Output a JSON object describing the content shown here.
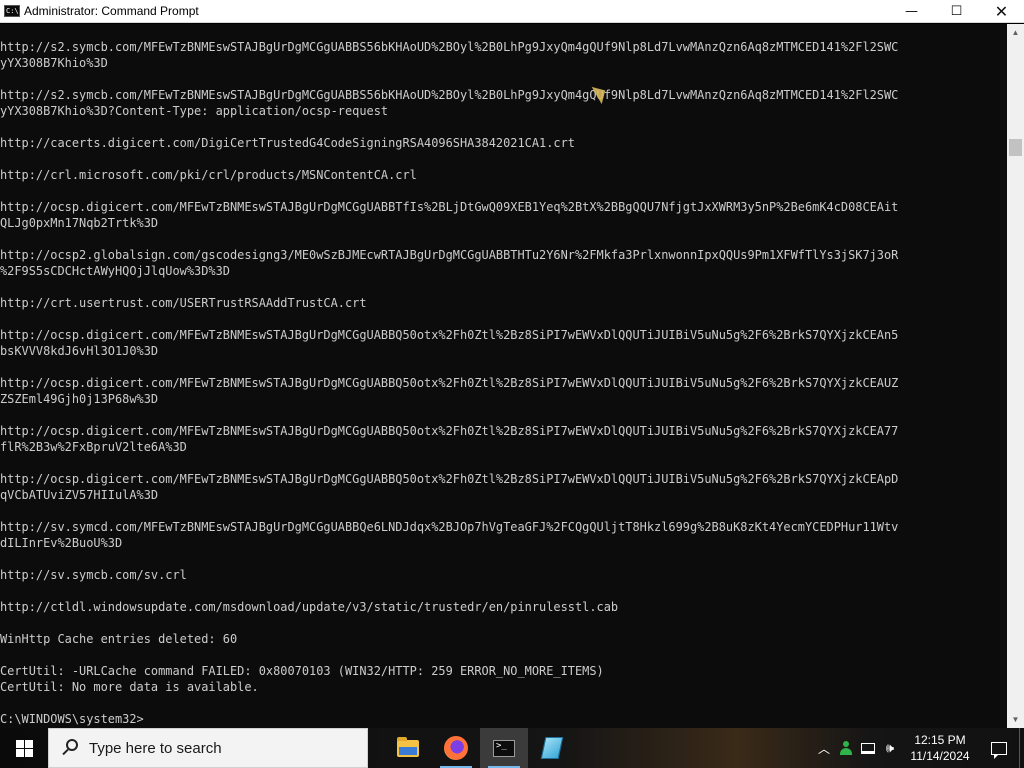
{
  "window": {
    "title": "Administrator: Command Prompt",
    "icon_name": "cmd-icon",
    "controls": {
      "minimize": "—",
      "maximize": "☐",
      "close": "✕"
    }
  },
  "console": {
    "text_color": "#cccccc",
    "background": "#0c0c0c",
    "lines": [
      "http://s2.symcb.com/MFEwTzBNMEswSTAJBgUrDgMCGgUABBS56bKHAoUD%2BOyl%2B0LhPg9JxyQm4gQUf9Nlp8Ld7LvwMAnzQzn6Aq8zMTMCED141%2Fl2SWC",
      "yYX308B7Khio%3D",
      "",
      "http://s2.symcb.com/MFEwTzBNMEswSTAJBgUrDgMCGgUABBS56bKHAoUD%2BOyl%2B0LhPg9JxyQm4gQUf9Nlp8Ld7LvwMAnzQzn6Aq8zMTMCED141%2Fl2SWC",
      "yYX308B7Khio%3D?Content-Type: application/ocsp-request",
      "",
      "http://cacerts.digicert.com/DigiCertTrustedG4CodeSigningRSA4096SHA3842021CA1.crt",
      "",
      "http://crl.microsoft.com/pki/crl/products/MSNContentCA.crl",
      "",
      "http://ocsp.digicert.com/MFEwTzBNMEswSTAJBgUrDgMCGgUABBTfIs%2BLjDtGwQ09XEB1Yeq%2BtX%2BBgQQU7NfjgtJxXWRM3y5nP%2Be6mK4cD08CEAit",
      "QLJg0pxMn17Nqb2Trtk%3D",
      "",
      "http://ocsp2.globalsign.com/gscodesigng3/ME0wSzBJMEcwRTAJBgUrDgMCGgUABBTHTu2Y6Nr%2FMkfa3PrlxnwonnIpxQQUs9Pm1XFWfTlYs3jSK7j3oR",
      "%2F9S5sCDCHctAWyHQOjJlqUow%3D%3D",
      "",
      "http://crt.usertrust.com/USERTrustRSAAddTrustCA.crt",
      "",
      "http://ocsp.digicert.com/MFEwTzBNMEswSTAJBgUrDgMCGgUABBQ50otx%2Fh0Ztl%2Bz8SiPI7wEWVxDlQQUTiJUIBiV5uNu5g%2F6%2BrkS7QYXjzkCEAn5",
      "bsKVVV8kdJ6vHl3O1J0%3D",
      "",
      "http://ocsp.digicert.com/MFEwTzBNMEswSTAJBgUrDgMCGgUABBQ50otx%2Fh0Ztl%2Bz8SiPI7wEWVxDlQQUTiJUIBiV5uNu5g%2F6%2BrkS7QYXjzkCEAUZ",
      "ZSZEml49Gjh0j13P68w%3D",
      "",
      "http://ocsp.digicert.com/MFEwTzBNMEswSTAJBgUrDgMCGgUABBQ50otx%2Fh0Ztl%2Bz8SiPI7wEWVxDlQQUTiJUIBiV5uNu5g%2F6%2BrkS7QYXjzkCEA77",
      "flR%2B3w%2FxBpruV2lte6A%3D",
      "",
      "http://ocsp.digicert.com/MFEwTzBNMEswSTAJBgUrDgMCGgUABBQ50otx%2Fh0Ztl%2Bz8SiPI7wEWVxDlQQUTiJUIBiV5uNu5g%2F6%2BrkS7QYXjzkCEApD",
      "qVCbATUviZV57HIIulA%3D",
      "",
      "http://sv.symcd.com/MFEwTzBNMEswSTAJBgUrDgMCGgUABBQe6LNDJdqx%2BJOp7hVgTeaGFJ%2FCQgQUljtT8Hkzl699g%2B8uK8zKt4YecmYCEDPHur11Wtv",
      "dILInrEv%2BuoU%3D",
      "",
      "http://sv.symcb.com/sv.crl",
      "",
      "http://ctldl.windowsupdate.com/msdownload/update/v3/static/trustedr/en/pinrulesstl.cab",
      "",
      "WinHttp Cache entries deleted: 60",
      "",
      "CertUtil: -URLCache command FAILED: 0x80070103 (WIN32/HTTP: 259 ERROR_NO_MORE_ITEMS)",
      "CertUtil: No more data is available.",
      "",
      "C:\\WINDOWS\\system32>"
    ]
  },
  "scrollbar": {
    "up_arrow": "▲",
    "down_arrow": "▼"
  },
  "taskbar": {
    "search_placeholder": "Type here to search",
    "pinned_apps": [
      {
        "name": "file-explorer-icon",
        "state": "pinned"
      },
      {
        "name": "firefox-icon",
        "state": "running"
      },
      {
        "name": "cmd-icon",
        "state": "active"
      },
      {
        "name": "notepad-icon",
        "state": "pinned"
      }
    ],
    "tray": {
      "chevron": "︿",
      "speaker": "🕪",
      "time": "12:15 PM",
      "date": "11/14/2024"
    }
  }
}
